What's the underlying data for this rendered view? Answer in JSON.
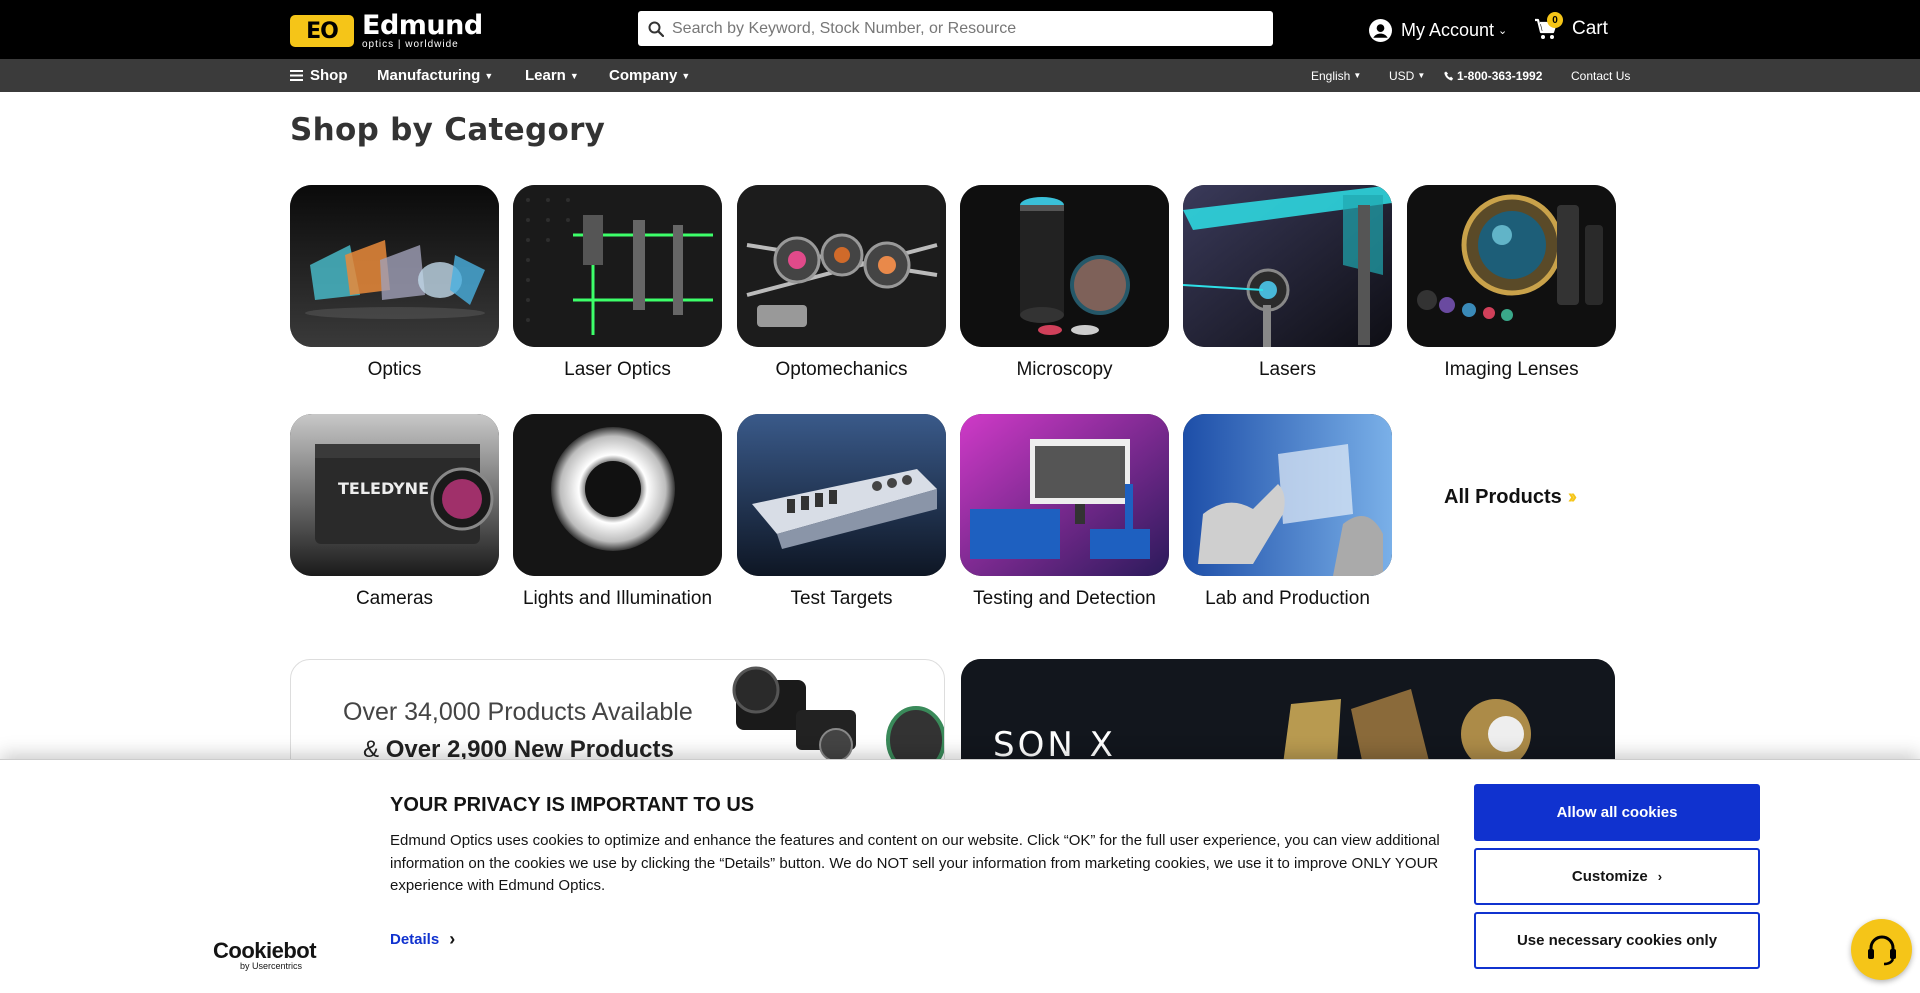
{
  "header": {
    "logo_mark": "EO",
    "logo_name": "Edmund",
    "logo_sub": "optics | worldwide",
    "search_placeholder": "Search by Keyword, Stock Number, or Resource",
    "account_label": "My Account",
    "cart_label": "Cart",
    "cart_count": "0",
    "icons": [
      "search-icon",
      "user-icon",
      "cart-icon"
    ]
  },
  "nav": {
    "shop": "Shop",
    "manufacturing": "Manufacturing",
    "learn": "Learn",
    "company": "Company",
    "language": "English",
    "currency": "USD",
    "phone": "1-800-363-1992",
    "contact": "Contact Us"
  },
  "main": {
    "title": "Shop by Category",
    "categories": [
      {
        "label": "Optics"
      },
      {
        "label": "Laser Optics"
      },
      {
        "label": "Optomechanics"
      },
      {
        "label": "Microscopy"
      },
      {
        "label": "Lasers"
      },
      {
        "label": "Imaging Lenses"
      },
      {
        "label": "Cameras"
      },
      {
        "label": "Lights and Illumination"
      },
      {
        "label": "Test Targets"
      },
      {
        "label": "Testing and Detection"
      },
      {
        "label": "Lab and Production"
      }
    ],
    "all_products": "All Products",
    "banner_left": {
      "line1": "Over 34,000 Products Available",
      "line2_prefix": "&",
      "line2_bold": "Over 2,900 New Products"
    },
    "banner_right": {
      "text": "SON X"
    }
  },
  "cookie": {
    "title": "YOUR PRIVACY IS IMPORTANT TO US",
    "text": "Edmund Optics uses cookies to optimize and enhance the features and content on our website. Click “OK” for the full user experience, you can view additional information on the cookies we use by clicking the “Details” button. We do NOT sell your information from marketing cookies, we use it to improve ONLY YOUR experience with Edmund Optics.",
    "details": "Details",
    "brand": "Cookiebot",
    "brand_sub": "by Usercentrics",
    "allow_all": "Allow all cookies",
    "customize": "Customize",
    "necessary_only": "Use necessary cookies only",
    "accent_color": "#1032cf"
  },
  "theme": {
    "brand_yellow": "#f5c518",
    "topbar": "#000000",
    "navbar": "#3b3b3b"
  }
}
